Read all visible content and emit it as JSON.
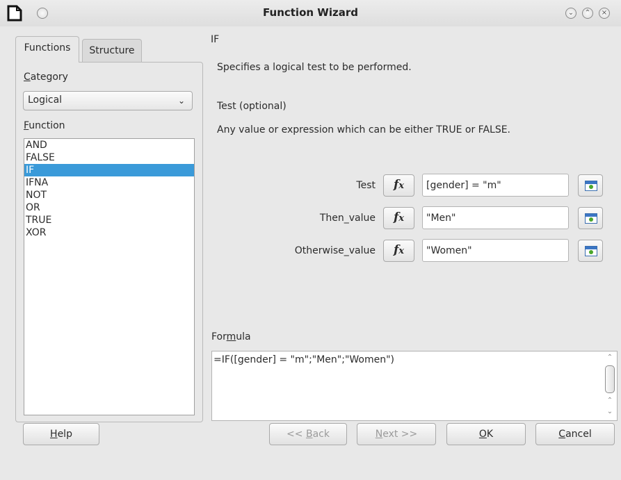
{
  "window": {
    "title": "Function Wizard"
  },
  "tabs": [
    {
      "label": "Functions"
    },
    {
      "label": "Structure"
    }
  ],
  "category": {
    "label": "Category",
    "selected": "Logical"
  },
  "function_list": {
    "label": "Function",
    "items": [
      "AND",
      "FALSE",
      "IF",
      "IFNA",
      "NOT",
      "OR",
      "TRUE",
      "XOR"
    ],
    "selected": "IF"
  },
  "function_info": {
    "name": "IF",
    "description": "Specifies a logical test to be performed.",
    "arg_title": "Test (optional)",
    "arg_description": "Any value or expression which can be either TRUE or FALSE."
  },
  "arguments": [
    {
      "label": "Test",
      "value": "[gender] = \"m\""
    },
    {
      "label": "Then_value",
      "value": "\"Men\""
    },
    {
      "label": "Otherwise_value",
      "value": "\"Women\""
    }
  ],
  "fx_label": "fx",
  "formula": {
    "label": "Formula",
    "value": "=IF([gender] = \"m\";\"Men\";\"Women\")"
  },
  "buttons": {
    "help": "Help",
    "back": "<< Back",
    "next": "Next >>",
    "ok": "OK",
    "cancel": "Cancel"
  }
}
